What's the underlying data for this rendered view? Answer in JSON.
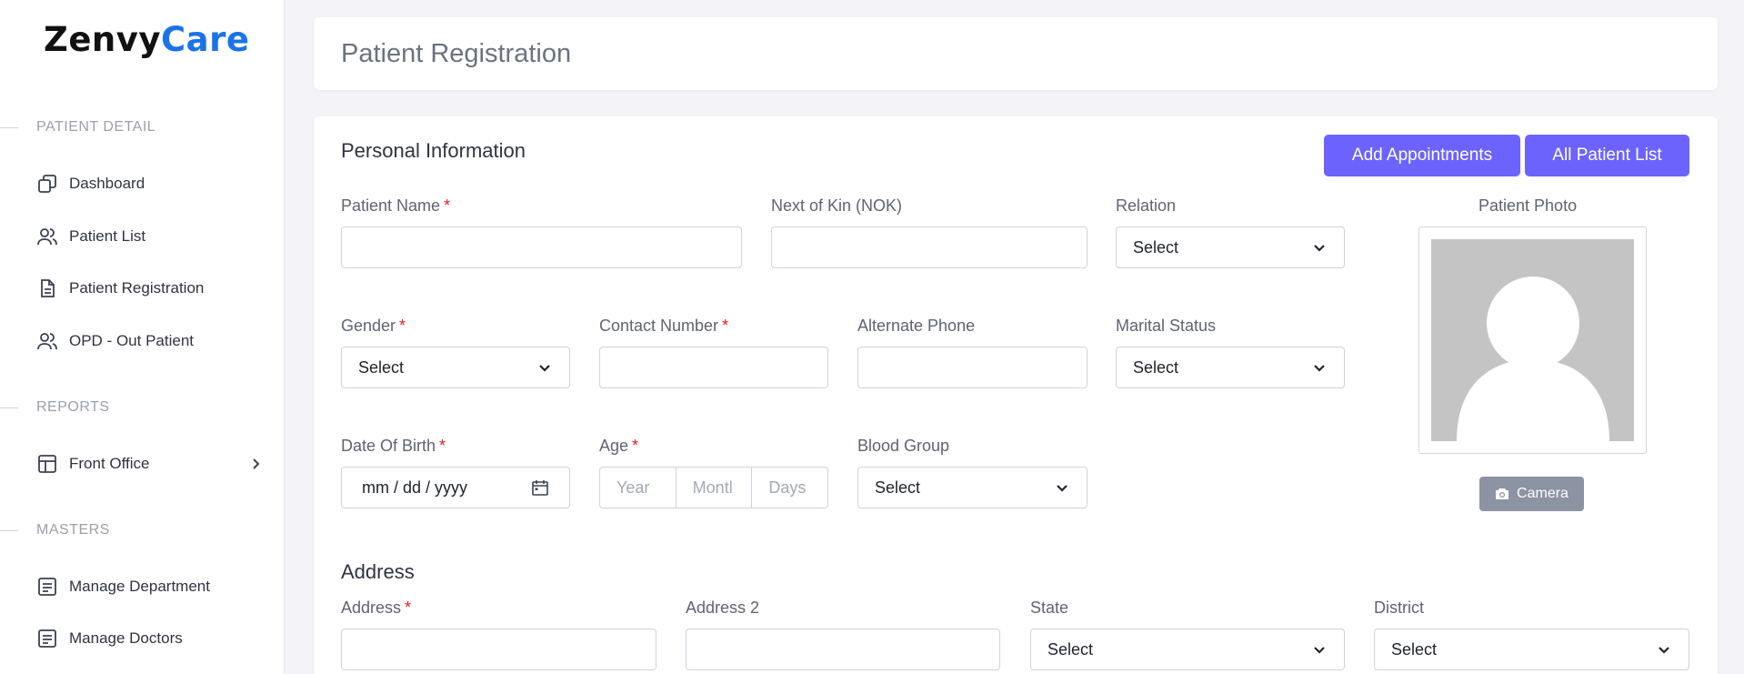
{
  "brand": {
    "part1": "Zenvy",
    "part2": "Care"
  },
  "sidebar": {
    "sections": [
      {
        "title": "PATIENT DETAIL"
      },
      {
        "title": "REPORTS"
      },
      {
        "title": "MASTERS"
      }
    ],
    "items": [
      {
        "label": "Dashboard",
        "icon": "dashboard-icon"
      },
      {
        "label": "Patient List",
        "icon": "users-icon"
      },
      {
        "label": "Patient Registration",
        "icon": "document-icon"
      },
      {
        "label": "OPD - Out Patient",
        "icon": "users-icon"
      },
      {
        "label": "Front Office",
        "icon": "layout-icon"
      },
      {
        "label": "Manage Department",
        "icon": "list-icon"
      },
      {
        "label": "Manage Doctors",
        "icon": "list-icon"
      }
    ]
  },
  "header": {
    "title": "Patient Registration"
  },
  "form": {
    "personal_title": "Personal Information",
    "add_appointments": "Add Appointments",
    "all_patient_list": "All Patient List",
    "labels": {
      "patient_name": "Patient Name",
      "nok": "Next of Kin (NOK)",
      "relation": "Relation",
      "patient_photo": "Patient Photo",
      "gender": "Gender",
      "contact_number": "Contact Number",
      "alternate_phone": "Alternate Phone",
      "marital_status": "Marital Status",
      "dob": "Date Of Birth",
      "age": "Age",
      "blood_group": "Blood Group",
      "address_section": "Address",
      "address": "Address",
      "address2": "Address 2",
      "state": "State",
      "district": "District"
    },
    "required_mark": "*",
    "select_text": "Select",
    "dob_placeholder": "mm / dd / yyyy",
    "age_year": "Year",
    "age_month": "Montl",
    "age_days": "Days",
    "camera": "Camera"
  },
  "colors": {
    "accent": "#6c63ff",
    "brand_blue": "#1a73e8",
    "required": "#e01e1e"
  }
}
